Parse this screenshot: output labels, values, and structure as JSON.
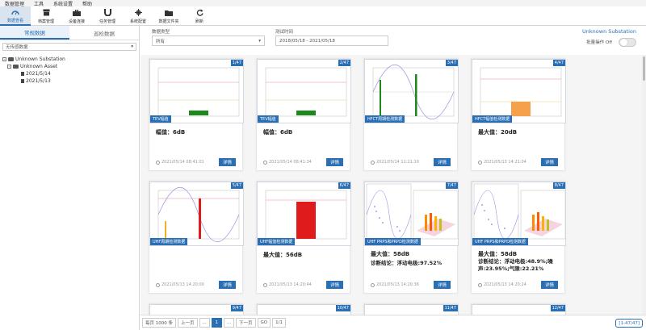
{
  "menu": [
    "数据管理",
    "工具",
    "系统设置",
    "帮助"
  ],
  "toolbar": [
    {
      "label": "数据查看",
      "icon": "gauge-icon",
      "active": true
    },
    {
      "label": "档案管理",
      "icon": "archive-icon"
    },
    {
      "label": "设备连接",
      "icon": "briefcase-icon"
    },
    {
      "label": "任务管理",
      "icon": "magnet-icon"
    },
    {
      "label": "系统配置",
      "icon": "gear-icon"
    },
    {
      "label": "数据文件夹",
      "icon": "folder-open-icon"
    },
    {
      "label": "刷新",
      "icon": "refresh-icon"
    }
  ],
  "sidebar": {
    "tabs": [
      "常规数据",
      "巡检数据"
    ],
    "select": "无传感数据",
    "tree": [
      {
        "label": "Unknown Substation",
        "level": 0,
        "kind": "folder"
      },
      {
        "label": "Unknown Asset",
        "level": 1,
        "kind": "folder"
      },
      {
        "label": "2021/5/14",
        "level": 2,
        "kind": "file"
      },
      {
        "label": "2021/5/13",
        "level": 2,
        "kind": "file"
      }
    ]
  },
  "filters": {
    "type_label": "数据类型",
    "type_value": "所有",
    "time_label": "测试时间",
    "time_value": "2018/05/18 - 2021/05/18",
    "station": "Unknown Substation",
    "batch_label": "批量操作 Off"
  },
  "cards": [
    {
      "page": "1/47",
      "type": "TEV幅值",
      "value": "幅值：6dB",
      "time": "2021/05/14 08:41:01",
      "detail": "详情"
    },
    {
      "page": "2/47",
      "type": "TEV幅值",
      "value": "幅值：6dB",
      "time": "2021/05/14 08:41:34",
      "detail": "详情"
    },
    {
      "page": "3/47",
      "type": "HFCT周期检测数据",
      "value": "",
      "time": "2021/05/14 11:21:10",
      "detail": "详情"
    },
    {
      "page": "4/47",
      "type": "HFCT幅值检测数据",
      "value": "最大值：20dB",
      "time": "2021/05/13 14:21:04",
      "detail": "详情"
    },
    {
      "page": "5/47",
      "type": "UHF周期检测数据",
      "value": "",
      "time": "2021/05/13 14:20:00",
      "detail": "详情"
    },
    {
      "page": "6/47",
      "type": "UHF幅值检测数据",
      "value": "最大值：56dB",
      "time": "2021/05/13 14:20:44",
      "detail": "详情"
    },
    {
      "page": "7/47",
      "type": "UHF PRPS和PRPD检测数据",
      "value": "最大值：58dB",
      "value2": "诊断结论：浮动电极:97.52%",
      "time": "2021/05/13 14:20:36",
      "detail": "详情"
    },
    {
      "page": "8/47",
      "type": "UHF PRPS和PRPD检测数据",
      "value": "最大值：58dB",
      "value2": "诊断结论：浮动电极:48.9%;噪声:23.95%;气隙:22.21%",
      "time": "2021/05/13 14:20:24",
      "detail": "详情"
    },
    {
      "page": "9/47"
    },
    {
      "page": "10/47"
    },
    {
      "page": "11/47"
    },
    {
      "page": "12/47"
    }
  ],
  "pager": {
    "per_page": "每页 1000 条",
    "prev": "上一页",
    "ellipsis1": "...",
    "current": "1",
    "ellipsis2": "...",
    "next": "下一页",
    "go": "GO",
    "page_of": "1/1",
    "count": "[1-47/47]"
  },
  "colors": {
    "accent": "#2a6fb3"
  }
}
